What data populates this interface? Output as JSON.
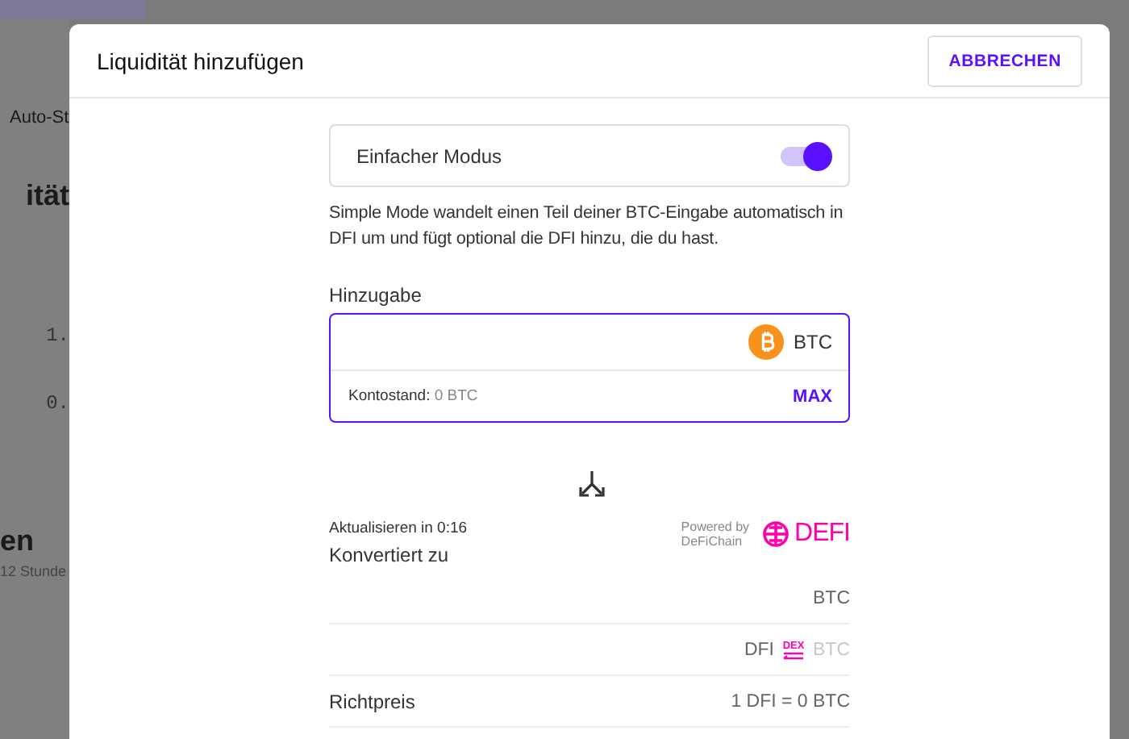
{
  "background": {
    "tab": "Auto-St",
    "heading": "ität",
    "values": [
      "1.",
      "0."
    ],
    "section_title": "en",
    "section_note": "12 Stunde"
  },
  "dialog": {
    "title": "Liquidität hinzufügen",
    "cancel_button": "ABBRECHEN"
  },
  "simple_mode": {
    "label": "Einfacher Modus",
    "on": true
  },
  "description": "Simple Mode wandelt einen Teil deiner BTC-Eingabe automatisch in DFI um und fügt optional die DFI hinzu, die du hast.",
  "input": {
    "label": "Hinzugabe",
    "token": "BTC",
    "balance_label": "Kontostand:",
    "balance_value": "0 BTC",
    "max_button": "MAX"
  },
  "conversion": {
    "refresh": "Aktualisieren in 0:16",
    "title": "Konvertiert zu",
    "powered_by": [
      "Powered by",
      "DeFiChain"
    ],
    "logo": "DEFI"
  },
  "rows": [
    {
      "kind": "token",
      "value": "BTC"
    },
    {
      "kind": "pair",
      "from": "DFI",
      "badge": "DEX",
      "to": "BTC"
    },
    {
      "kind": "price",
      "label": "Richtpreis",
      "value": "1 DFI = 0 BTC"
    }
  ]
}
